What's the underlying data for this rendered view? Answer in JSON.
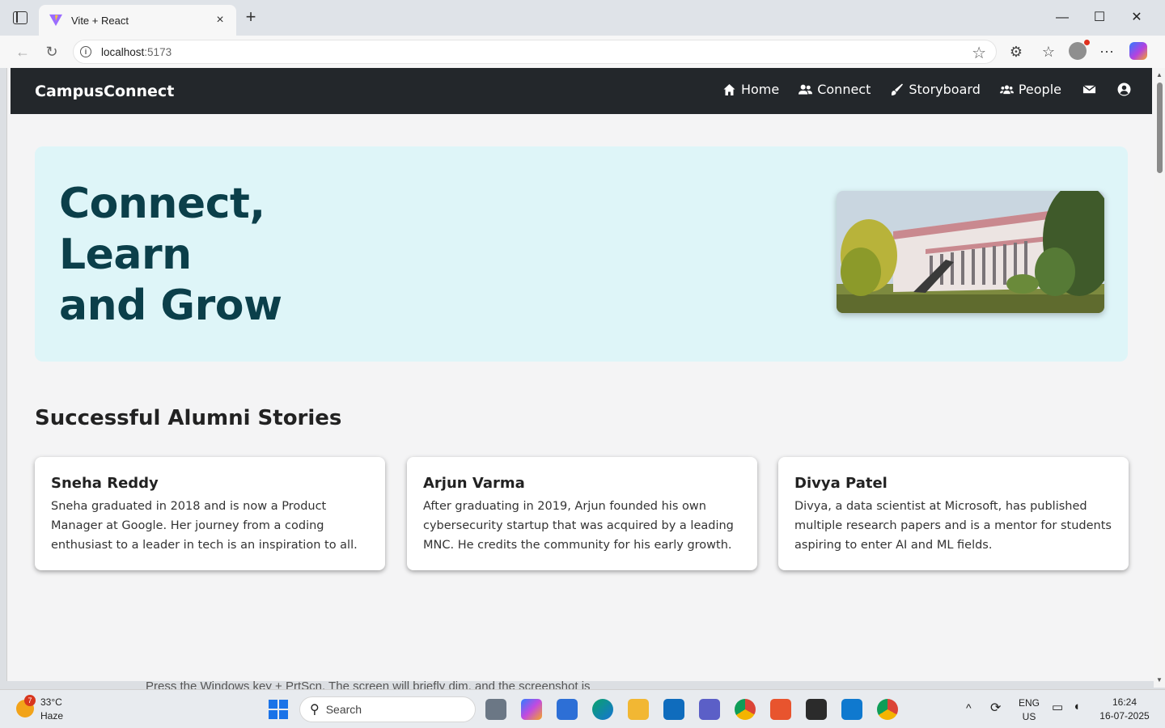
{
  "browser": {
    "tab_title": "Vite + React",
    "url_host": "localhost",
    "url_port": ":5173",
    "new_tab": "+",
    "close_tab": "×",
    "minimize": "—",
    "maximize": "☐",
    "close_window": "✕"
  },
  "nav": {
    "brand": "CampusConnect",
    "links": [
      {
        "label": "Home",
        "icon": "home-icon"
      },
      {
        "label": "Connect",
        "icon": "users-icon"
      },
      {
        "label": "Storyboard",
        "icon": "brush-icon"
      },
      {
        "label": "People",
        "icon": "people-icon"
      }
    ],
    "icon_links": [
      "envelope-icon",
      "user-circle-icon"
    ]
  },
  "hero": {
    "line1": "Connect,",
    "line2": "Learn",
    "line3": "and Grow"
  },
  "stories": {
    "title": "Successful Alumni Stories",
    "cards": [
      {
        "name": "Sneha Reddy",
        "text": "Sneha graduated in 2018 and is now a Product Manager at Google. Her journey from a coding enthusiast to a leader in tech is an inspiration to all."
      },
      {
        "name": "Arjun Varma",
        "text": "After graduating in 2019, Arjun founded his own cybersecurity startup that was acquired by a leading MNC. He credits the community for his early growth."
      },
      {
        "name": "Divya Patel",
        "text": "Divya, a data scientist at Microsoft, has published multiple research papers and is a mentor for students aspiring to enter AI and ML fields."
      }
    ]
  },
  "overlay_text": "Press the Windows key + PrtScn. The screen will briefly dim, and the screenshot is",
  "taskbar": {
    "weather_badge": "7",
    "temperature": "33°C",
    "condition": "Haze",
    "search_label": "Search",
    "lang": "ENG",
    "region": "US",
    "time": "16:24",
    "date": "16-07-2025"
  },
  "colors": {
    "navbar": "#23272b",
    "hero_bg": "#def5f8",
    "hero_text": "#0b3f4a"
  }
}
